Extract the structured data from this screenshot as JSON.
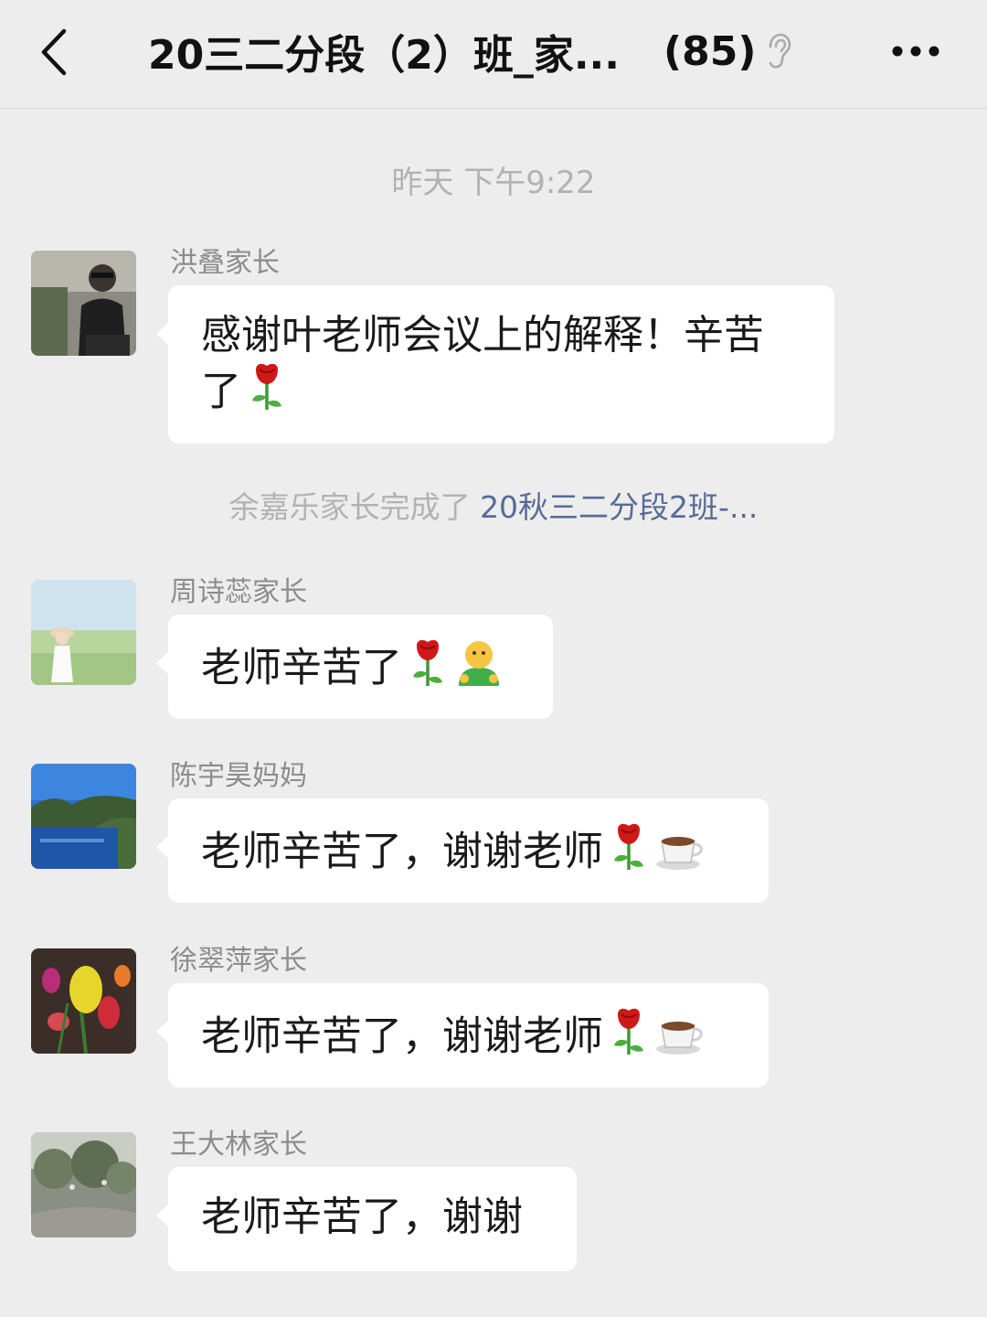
{
  "header": {
    "title": "20三二分段（2）班_家...",
    "member_count": "(85)"
  },
  "time_label": "昨天 下午9:22",
  "system_message": {
    "text": "余嘉乐家长完成了",
    "link": "20秋三二分段2班-..."
  },
  "messages": [
    {
      "sender": "洪叠家长",
      "text": "感谢叶老师会议上的解释！辛苦了",
      "emojis": [
        "rose"
      ]
    },
    {
      "sender": "周诗蕊家长",
      "text": "老师辛苦了",
      "emojis": [
        "rose",
        "person"
      ]
    },
    {
      "sender": "陈宇昊妈妈",
      "text": "老师辛苦了，谢谢老师",
      "emojis": [
        "rose",
        "coffee"
      ]
    },
    {
      "sender": "徐翠萍家长",
      "text": "老师辛苦了，谢谢老师",
      "emojis": [
        "rose",
        "coffee"
      ]
    },
    {
      "sender": "王大林家长",
      "text": "老师辛苦了，谢谢",
      "emojis": []
    }
  ],
  "colors": {
    "background": "#ededed",
    "bubble": "#ffffff",
    "link": "#576b95",
    "meta_text": "#b2b2b2"
  },
  "icons": [
    "back-arrow-icon",
    "ear-icon",
    "more-dots-icon",
    "rose-emoji",
    "person-emoji",
    "coffee-emoji"
  ]
}
